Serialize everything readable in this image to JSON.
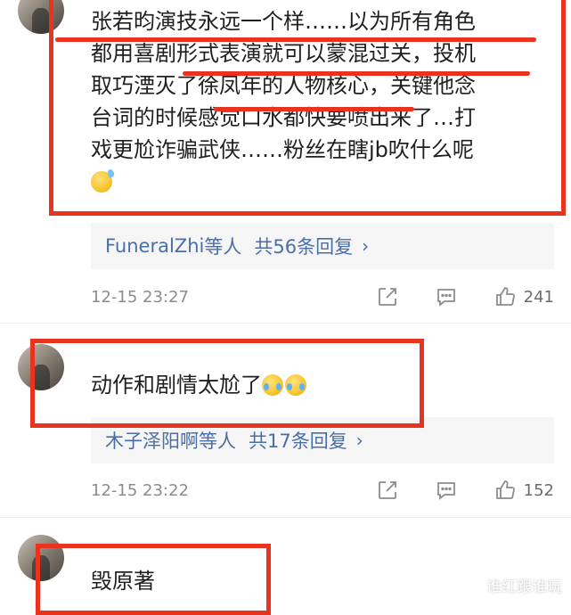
{
  "comments": [
    {
      "text_lines": [
        "张若昀演技永远一个样……以为所有角色",
        "都用喜剧形式表演就可以蒙混过关，投机",
        "取巧湮灭了徐凤年的人物核心，关键他念",
        "台词的时候感觉口水都快要喷出来了…打",
        "戏更尬诈骗武侠……粉丝在瞎jb吹什么呢"
      ],
      "emoji": "sweat-emoji",
      "replies": {
        "users": "FuneralZhi",
        "suffix": "等人",
        "count_label": "共56条回复"
      },
      "time": "12-15 23:27",
      "likes": "241"
    },
    {
      "text": "动作和剧情太尬了",
      "emoji": "crying-laughing-emoji",
      "replies": {
        "users": "木子泽阳啊",
        "suffix": "等人",
        "count_label": "共17条回复"
      },
      "time": "12-15 23:22",
      "likes": "152"
    },
    {
      "text": "毁原著"
    }
  ],
  "watermark": "谁红跟谁玩",
  "colors": {
    "annotation_red": "#e8341f",
    "link_blue": "#4a6ea8",
    "reply_bg": "#f5f5f5"
  }
}
